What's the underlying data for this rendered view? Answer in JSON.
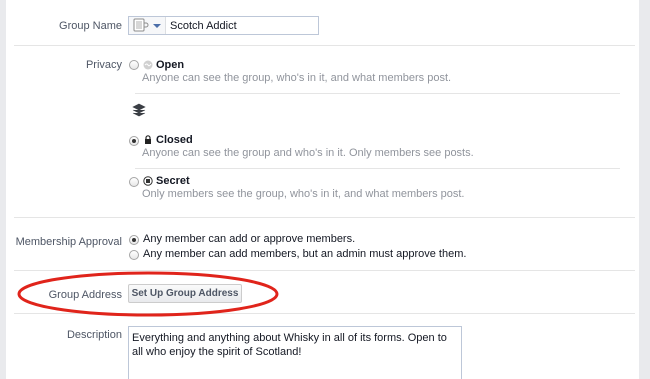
{
  "group_name": {
    "label": "Group Name",
    "value": "Scotch Addict"
  },
  "privacy": {
    "label": "Privacy",
    "options": [
      {
        "title": "Open",
        "desc": "Anyone can see the group, who's in it, and what members post."
      },
      {
        "title": "Closed",
        "desc": "Anyone can see the group and who's in it. Only members see posts."
      },
      {
        "title": "Secret",
        "desc": "Only members see the group, who's in it, and what members post."
      }
    ]
  },
  "membership": {
    "label": "Membership Approval",
    "options": [
      "Any member can add or approve members.",
      "Any member can add members, but an admin must approve them."
    ]
  },
  "address": {
    "label": "Group Address",
    "button": "Set Up Group Address"
  },
  "description": {
    "label": "Description",
    "value": "Everything and anything about Whisky in all of its forms. Open to all who enjoy the spirit of Scotland!"
  },
  "colors": {
    "annotation": "#e0241b",
    "divider": "#e5e5e5"
  },
  "icons": [
    "group-icon",
    "chevron-down-icon",
    "globe-icon",
    "stack-icon",
    "lock-icon",
    "secret-icon"
  ],
  "selected": {
    "privacy": "Closed",
    "membership": 0
  }
}
